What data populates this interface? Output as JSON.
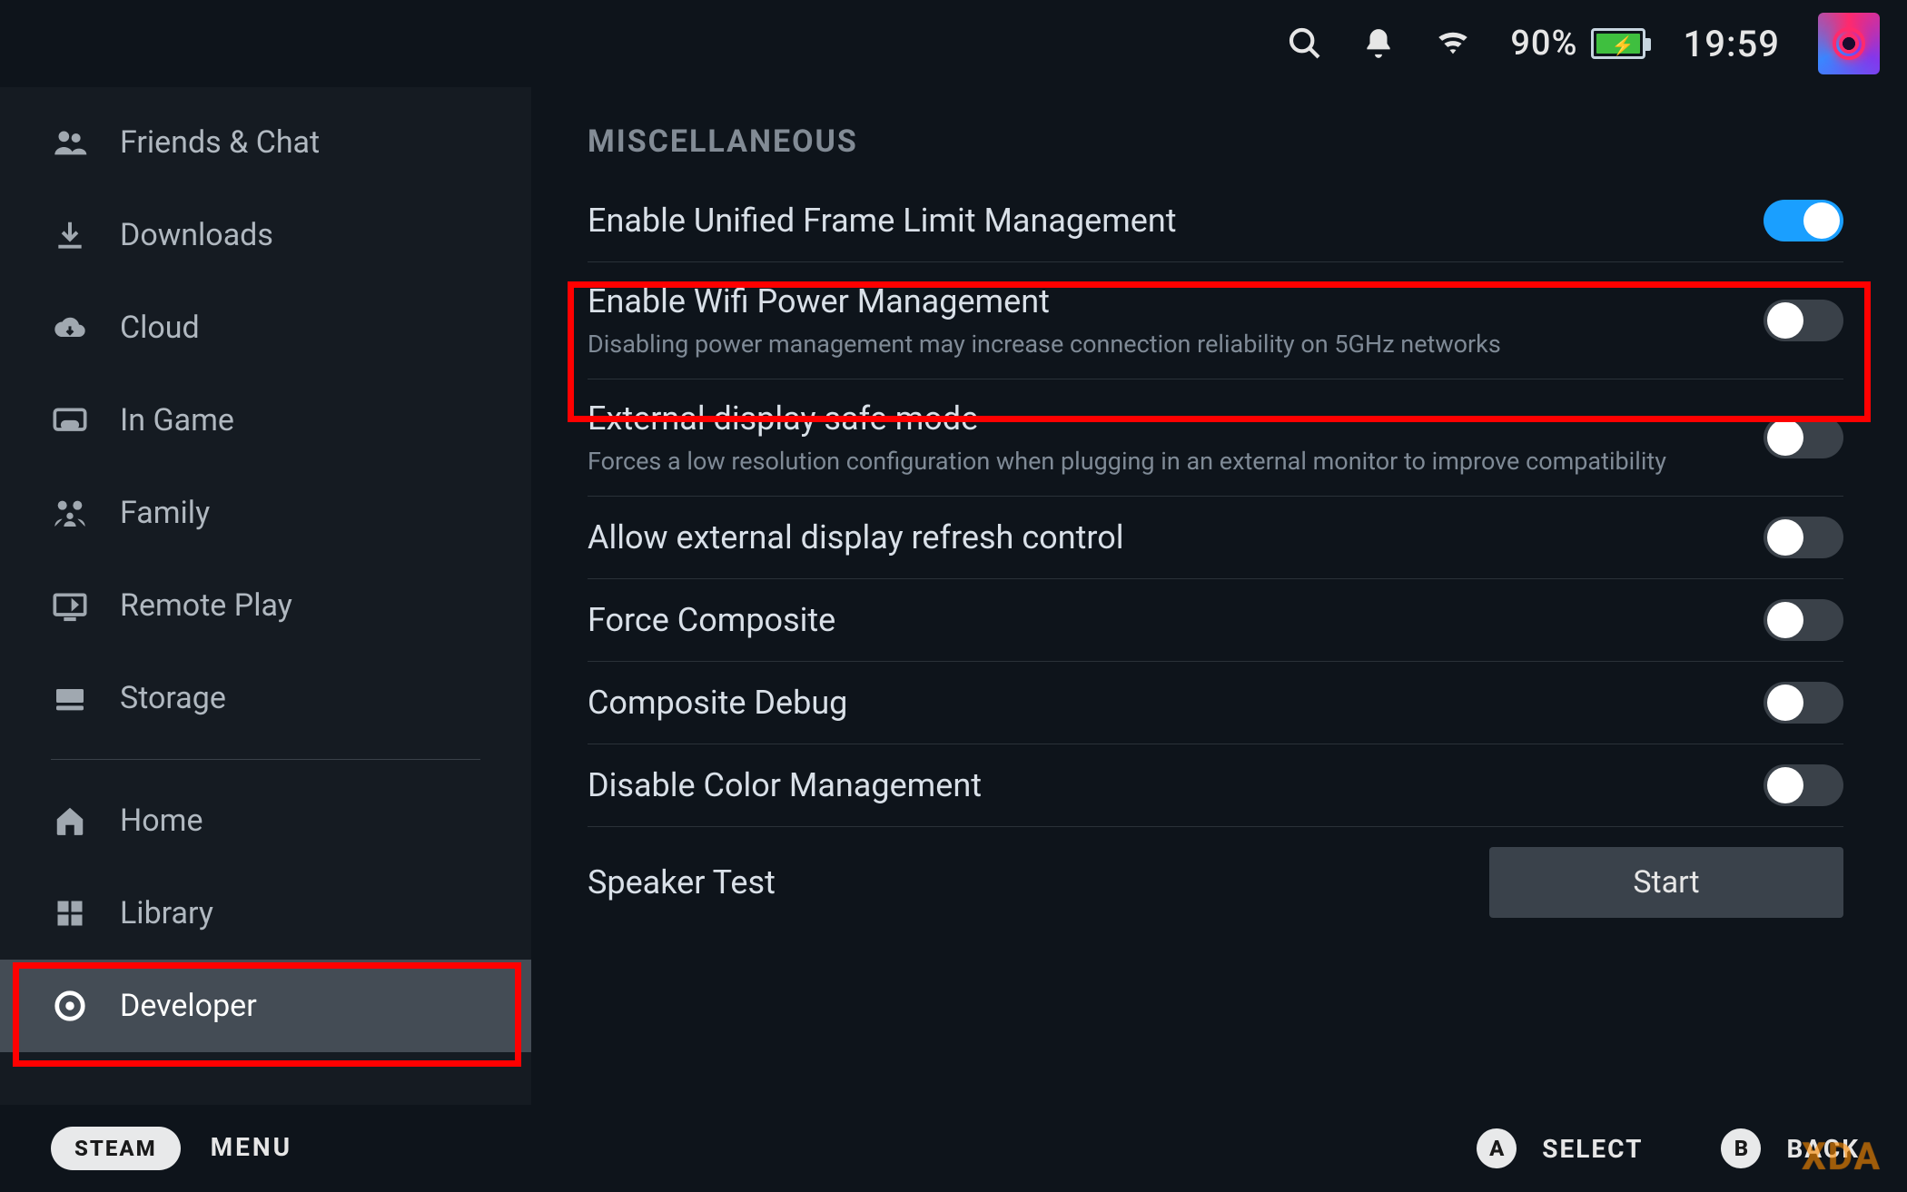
{
  "status": {
    "battery_pct": "90%",
    "clock": "19:59"
  },
  "sidebar": {
    "items": [
      {
        "id": "friends-chat",
        "label": "Friends & Chat",
        "icon": "friends"
      },
      {
        "id": "downloads",
        "label": "Downloads",
        "icon": "download"
      },
      {
        "id": "cloud",
        "label": "Cloud",
        "icon": "cloud"
      },
      {
        "id": "in-game",
        "label": "In Game",
        "icon": "ingame"
      },
      {
        "id": "family",
        "label": "Family",
        "icon": "family"
      },
      {
        "id": "remote-play",
        "label": "Remote Play",
        "icon": "remote"
      },
      {
        "id": "storage",
        "label": "Storage",
        "icon": "storage"
      }
    ],
    "items2": [
      {
        "id": "home",
        "label": "Home",
        "icon": "home"
      },
      {
        "id": "library",
        "label": "Library",
        "icon": "library"
      },
      {
        "id": "developer",
        "label": "Developer",
        "icon": "developer",
        "selected": true
      }
    ]
  },
  "main": {
    "section_title": "MISCELLANEOUS",
    "settings": [
      {
        "id": "uflm",
        "title": "Enable Unified Frame Limit Management",
        "desc": "",
        "state": "on"
      },
      {
        "id": "wifi-pm",
        "title": "Enable Wifi Power Management",
        "desc": "Disabling power management may increase connection reliability on 5GHz networks",
        "state": "off",
        "highlighted": true
      },
      {
        "id": "ext-safe",
        "title": "External display safe mode",
        "desc": "Forces a low resolution configuration when plugging in an external monitor to improve compatibility",
        "state": "off"
      },
      {
        "id": "ext-refresh",
        "title": "Allow external display refresh control",
        "desc": "",
        "state": "off"
      },
      {
        "id": "force-comp",
        "title": "Force Composite",
        "desc": "",
        "state": "off"
      },
      {
        "id": "comp-debug",
        "title": "Composite Debug",
        "desc": "",
        "state": "off"
      },
      {
        "id": "dis-colmgmt",
        "title": "Disable Color Management",
        "desc": "",
        "state": "off"
      }
    ],
    "speaker_test": {
      "title": "Speaker Test",
      "button": "Start"
    }
  },
  "footer": {
    "steam": "STEAM",
    "menu": "MENU",
    "a_key": "A",
    "a_label": "SELECT",
    "b_key": "B",
    "b_label": "BACK"
  },
  "watermark": "XDA"
}
